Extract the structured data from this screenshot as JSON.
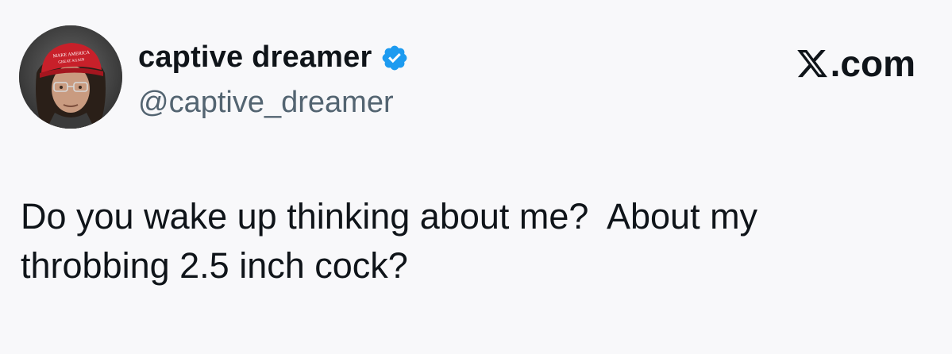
{
  "tweet": {
    "display_name": "captive dreamer",
    "handle": "@captive_dreamer",
    "verified": true,
    "text": "Do you wake up thinking about me?  About my\nthrobbing 2.5 inch cock?"
  },
  "platform": {
    "logo_text": ".com",
    "logo_icon": "x-logo-icon"
  },
  "avatar": {
    "icon": "profile-avatar",
    "hat_text": "MAKE AMERICA GREAT AGAIN"
  },
  "colors": {
    "background": "#f8f8fa",
    "text": "#0f1419",
    "handle": "#536471",
    "verified": "#1d9bf0",
    "hat": "#c8202a"
  }
}
